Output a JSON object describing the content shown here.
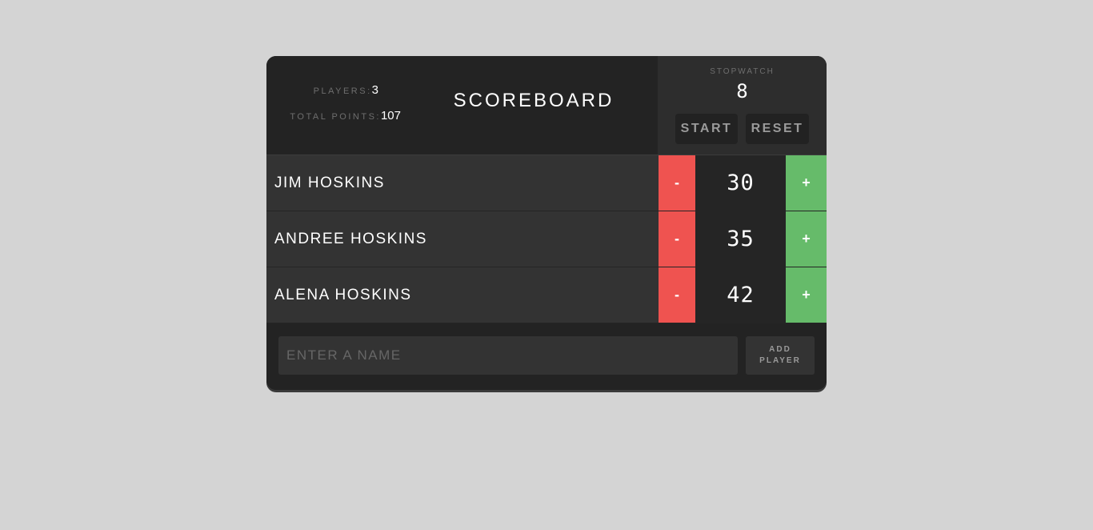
{
  "stats": {
    "players_label": "PLAYERS:",
    "players_value": "3",
    "total_label": "TOTAL POINTS:",
    "total_value": "107"
  },
  "title": "SCOREBOARD",
  "stopwatch": {
    "label": "STOPWATCH",
    "time": "8",
    "start_label": "START",
    "reset_label": "RESET"
  },
  "players": [
    {
      "name": "JIM HOSKINS",
      "score": "30",
      "dec_label": "-",
      "inc_label": "+"
    },
    {
      "name": "ANDREE HOSKINS",
      "score": "35",
      "dec_label": "-",
      "inc_label": "+"
    },
    {
      "name": "ALENA HOSKINS",
      "score": "42",
      "dec_label": "-",
      "inc_label": "+"
    }
  ],
  "add_player": {
    "placeholder": "ENTER A NAME",
    "value": "",
    "button_label": "ADD PLAYER"
  },
  "colors": {
    "page_background": "#d4d4d4",
    "board_background": "#232323",
    "decrement": "#ef5350",
    "increment": "#66bb6a"
  }
}
